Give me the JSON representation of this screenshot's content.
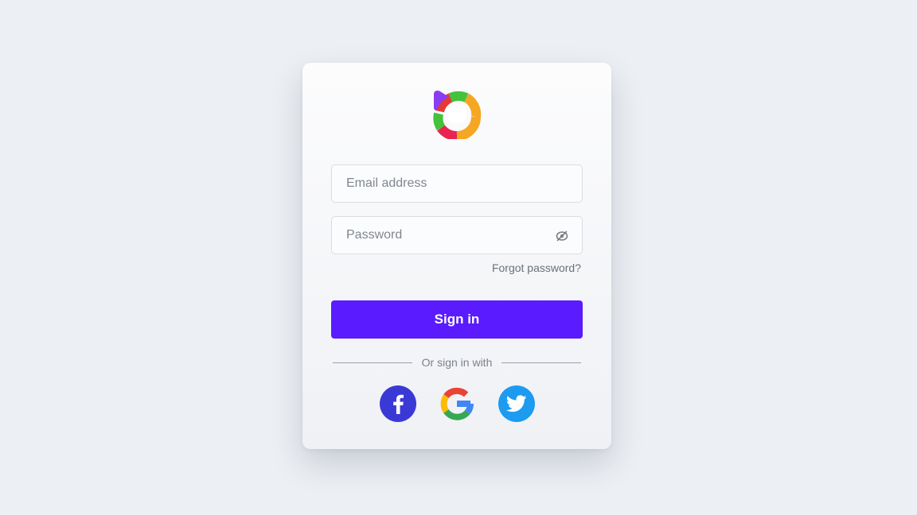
{
  "form": {
    "email_placeholder": "Email address",
    "password_placeholder": "Password",
    "forgot_label": "Forgot password?",
    "signin_label": "Sign in",
    "divider_label": "Or sign in with"
  },
  "icons": {
    "logo": "logo-icon",
    "password_toggle": "eye-off-icon",
    "facebook": "facebook-icon",
    "google": "google-icon",
    "twitter": "twitter-icon"
  },
  "colors": {
    "primary": "#5a1bff",
    "facebook": "#3b39d6",
    "twitter": "#1d9bf0",
    "background": "#eceff3"
  }
}
